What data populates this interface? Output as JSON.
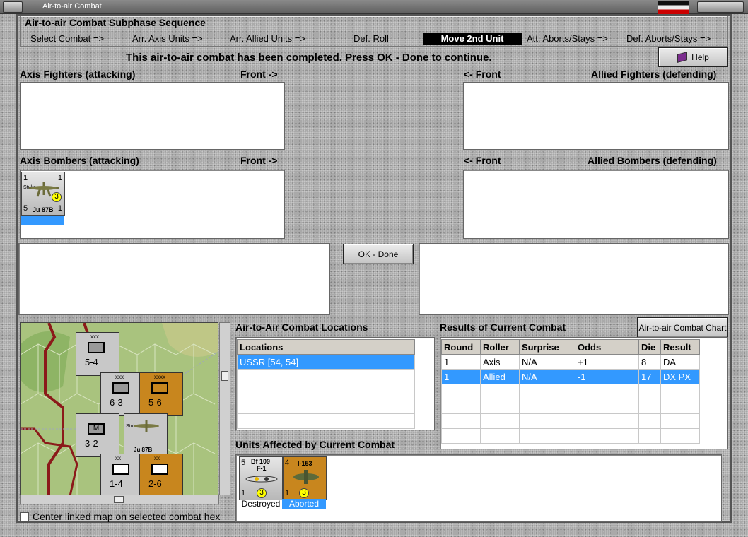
{
  "window": {
    "title": "Air-to-air Combat"
  },
  "sequence": {
    "title": "Air-to-air Combat Subphase Sequence",
    "steps": [
      "Select Combat =>",
      "Arr. Axis Units =>",
      "Arr. Allied Units =>",
      "Def. Roll",
      "Move 2nd Unit",
      "Att. Aborts/Stays =>",
      "Def. Aborts/Stays =>"
    ],
    "active_index": 4
  },
  "message": "This air-to-air combat has been completed.  Press OK - Done to continue.",
  "help_button": {
    "label": "Help",
    "icon": "help-book-icon"
  },
  "axis_fighters": {
    "label": "Axis Fighters (attacking)",
    "front": "Front ->"
  },
  "allied_fighters": {
    "label": "Allied Fighters (defending)",
    "front": "<- Front"
  },
  "axis_bombers": {
    "label": "Axis Bombers (attacking)",
    "front": "Front ->",
    "unit": {
      "top_left": "1",
      "top_right": "1",
      "name": "Stuka",
      "model": "Ju 87B",
      "bottom_left": "5",
      "bottom_right": "1",
      "badge": "3"
    }
  },
  "allied_bombers": {
    "label": "Allied Bombers (defending)",
    "front": "<- Front"
  },
  "ok_button": {
    "label": "OK - Done"
  },
  "map": {
    "counters": [
      {
        "stack": "3",
        "size": "xxx",
        "name": "XXIII Inf",
        "value": "5-4"
      },
      {
        "stack": "3",
        "size": "xxx",
        "name": "XXXVIII Inf",
        "value": "6-3"
      },
      {
        "stack": "3",
        "size": "xxxx",
        "name": "4th Army",
        "value": "5-6"
      },
      {
        "stack": "2",
        "size": "",
        "name": "Regensburg",
        "value": "3-2"
      },
      {
        "stack": "4",
        "size": "",
        "name": "Stuka",
        "value": "Ju 87B"
      },
      {
        "stack": "3",
        "size": "xx",
        "name": "3rd Inf Div",
        "value": "1-4"
      },
      {
        "stack": "3",
        "size": "xx",
        "name": "4th Inf Div",
        "value": "2-6"
      }
    ],
    "center_checkbox_label": "Center linked map on selected combat hex"
  },
  "locations": {
    "title": "Air-to-Air Combat Locations",
    "header": "Locations",
    "rows": [
      "USSR [54, 54]"
    ]
  },
  "results": {
    "title": "Results of Current Combat",
    "chart_button": "Air-to-air Combat Chart",
    "columns": [
      "Round",
      "Roller",
      "Surprise",
      "Odds",
      "Die",
      "Result"
    ],
    "rows": [
      [
        "1",
        "Axis",
        "N/A",
        "+1",
        "8",
        "DA"
      ],
      [
        "1",
        "Allied",
        "N/A",
        "-1",
        "17",
        "DX PX"
      ]
    ],
    "selected_row": 1
  },
  "affected": {
    "title": "Units Affected by Current Combat",
    "units": [
      {
        "top_left": "5",
        "name": "Bf 109",
        "model": "F-1",
        "bottom_left": "1",
        "badge": "3",
        "status": "Destroyed"
      },
      {
        "top_left": "4",
        "name": "I-153",
        "model": "",
        "bottom_left": "1",
        "badge": "3",
        "status": "Aborted"
      }
    ]
  },
  "colors": {
    "selection": "#3399ff",
    "allied_counter": "#c8861e",
    "axis_counter": "#c0c0c0"
  }
}
